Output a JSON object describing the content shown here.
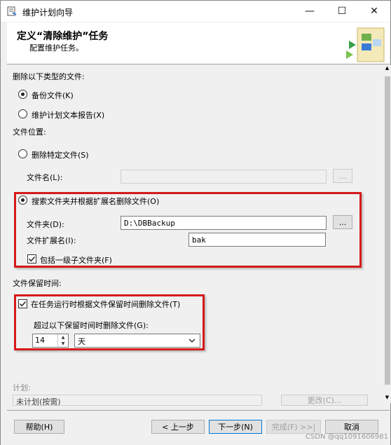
{
  "window": {
    "title": "维护计划向导",
    "controls": {
      "minimize": "—",
      "maximize": "☐",
      "close": "✕"
    }
  },
  "header": {
    "title": "定义“清除维护”任务",
    "subtitle": "配置维护任务。"
  },
  "delete_type": {
    "label": "删除以下类型的文件:",
    "options": [
      {
        "label": "备份文件(K)",
        "selected": true
      },
      {
        "label": "维护计划文本报告(X)",
        "selected": false
      }
    ]
  },
  "file_location": {
    "label": "文件位置:",
    "specific_file": {
      "option_label": "删除特定文件(S)",
      "selected": false,
      "filename_label": "文件名(L):",
      "filename_value": "",
      "browse_label": "..."
    },
    "search_folder": {
      "option_label": "搜索文件夹并根据扩展名删除文件(O)",
      "selected": true,
      "folder_label": "文件夹(D):",
      "folder_value": "D:\\DBBackup",
      "browse_label": "...",
      "extension_label": "文件扩展名(I):",
      "extension_value": "bak",
      "include_subfolders_label": "包括一级子文件夹(F)",
      "include_subfolders_checked": true
    }
  },
  "retention": {
    "label": "文件保留时间:",
    "delete_by_age_label": "在任务运行时根据文件保留时间删除文件(T)",
    "delete_by_age_checked": true,
    "older_than_label": "超过以下保留时间时删除文件(G):",
    "amount": "14",
    "unit": "天"
  },
  "schedule": {
    "label": "计划:",
    "value": "未计划(按需)",
    "change_label": "更改(C)..."
  },
  "footer": {
    "help": "帮助(H)",
    "back": "< 上一步",
    "next": "下一步(N)",
    "finish": "完成(F) >>|",
    "cancel": "取消"
  },
  "watermark": "CSDN @qq1091606981",
  "colors": {
    "highlight_border": "#d51a1a",
    "primary_button_border": "#0078d7"
  }
}
